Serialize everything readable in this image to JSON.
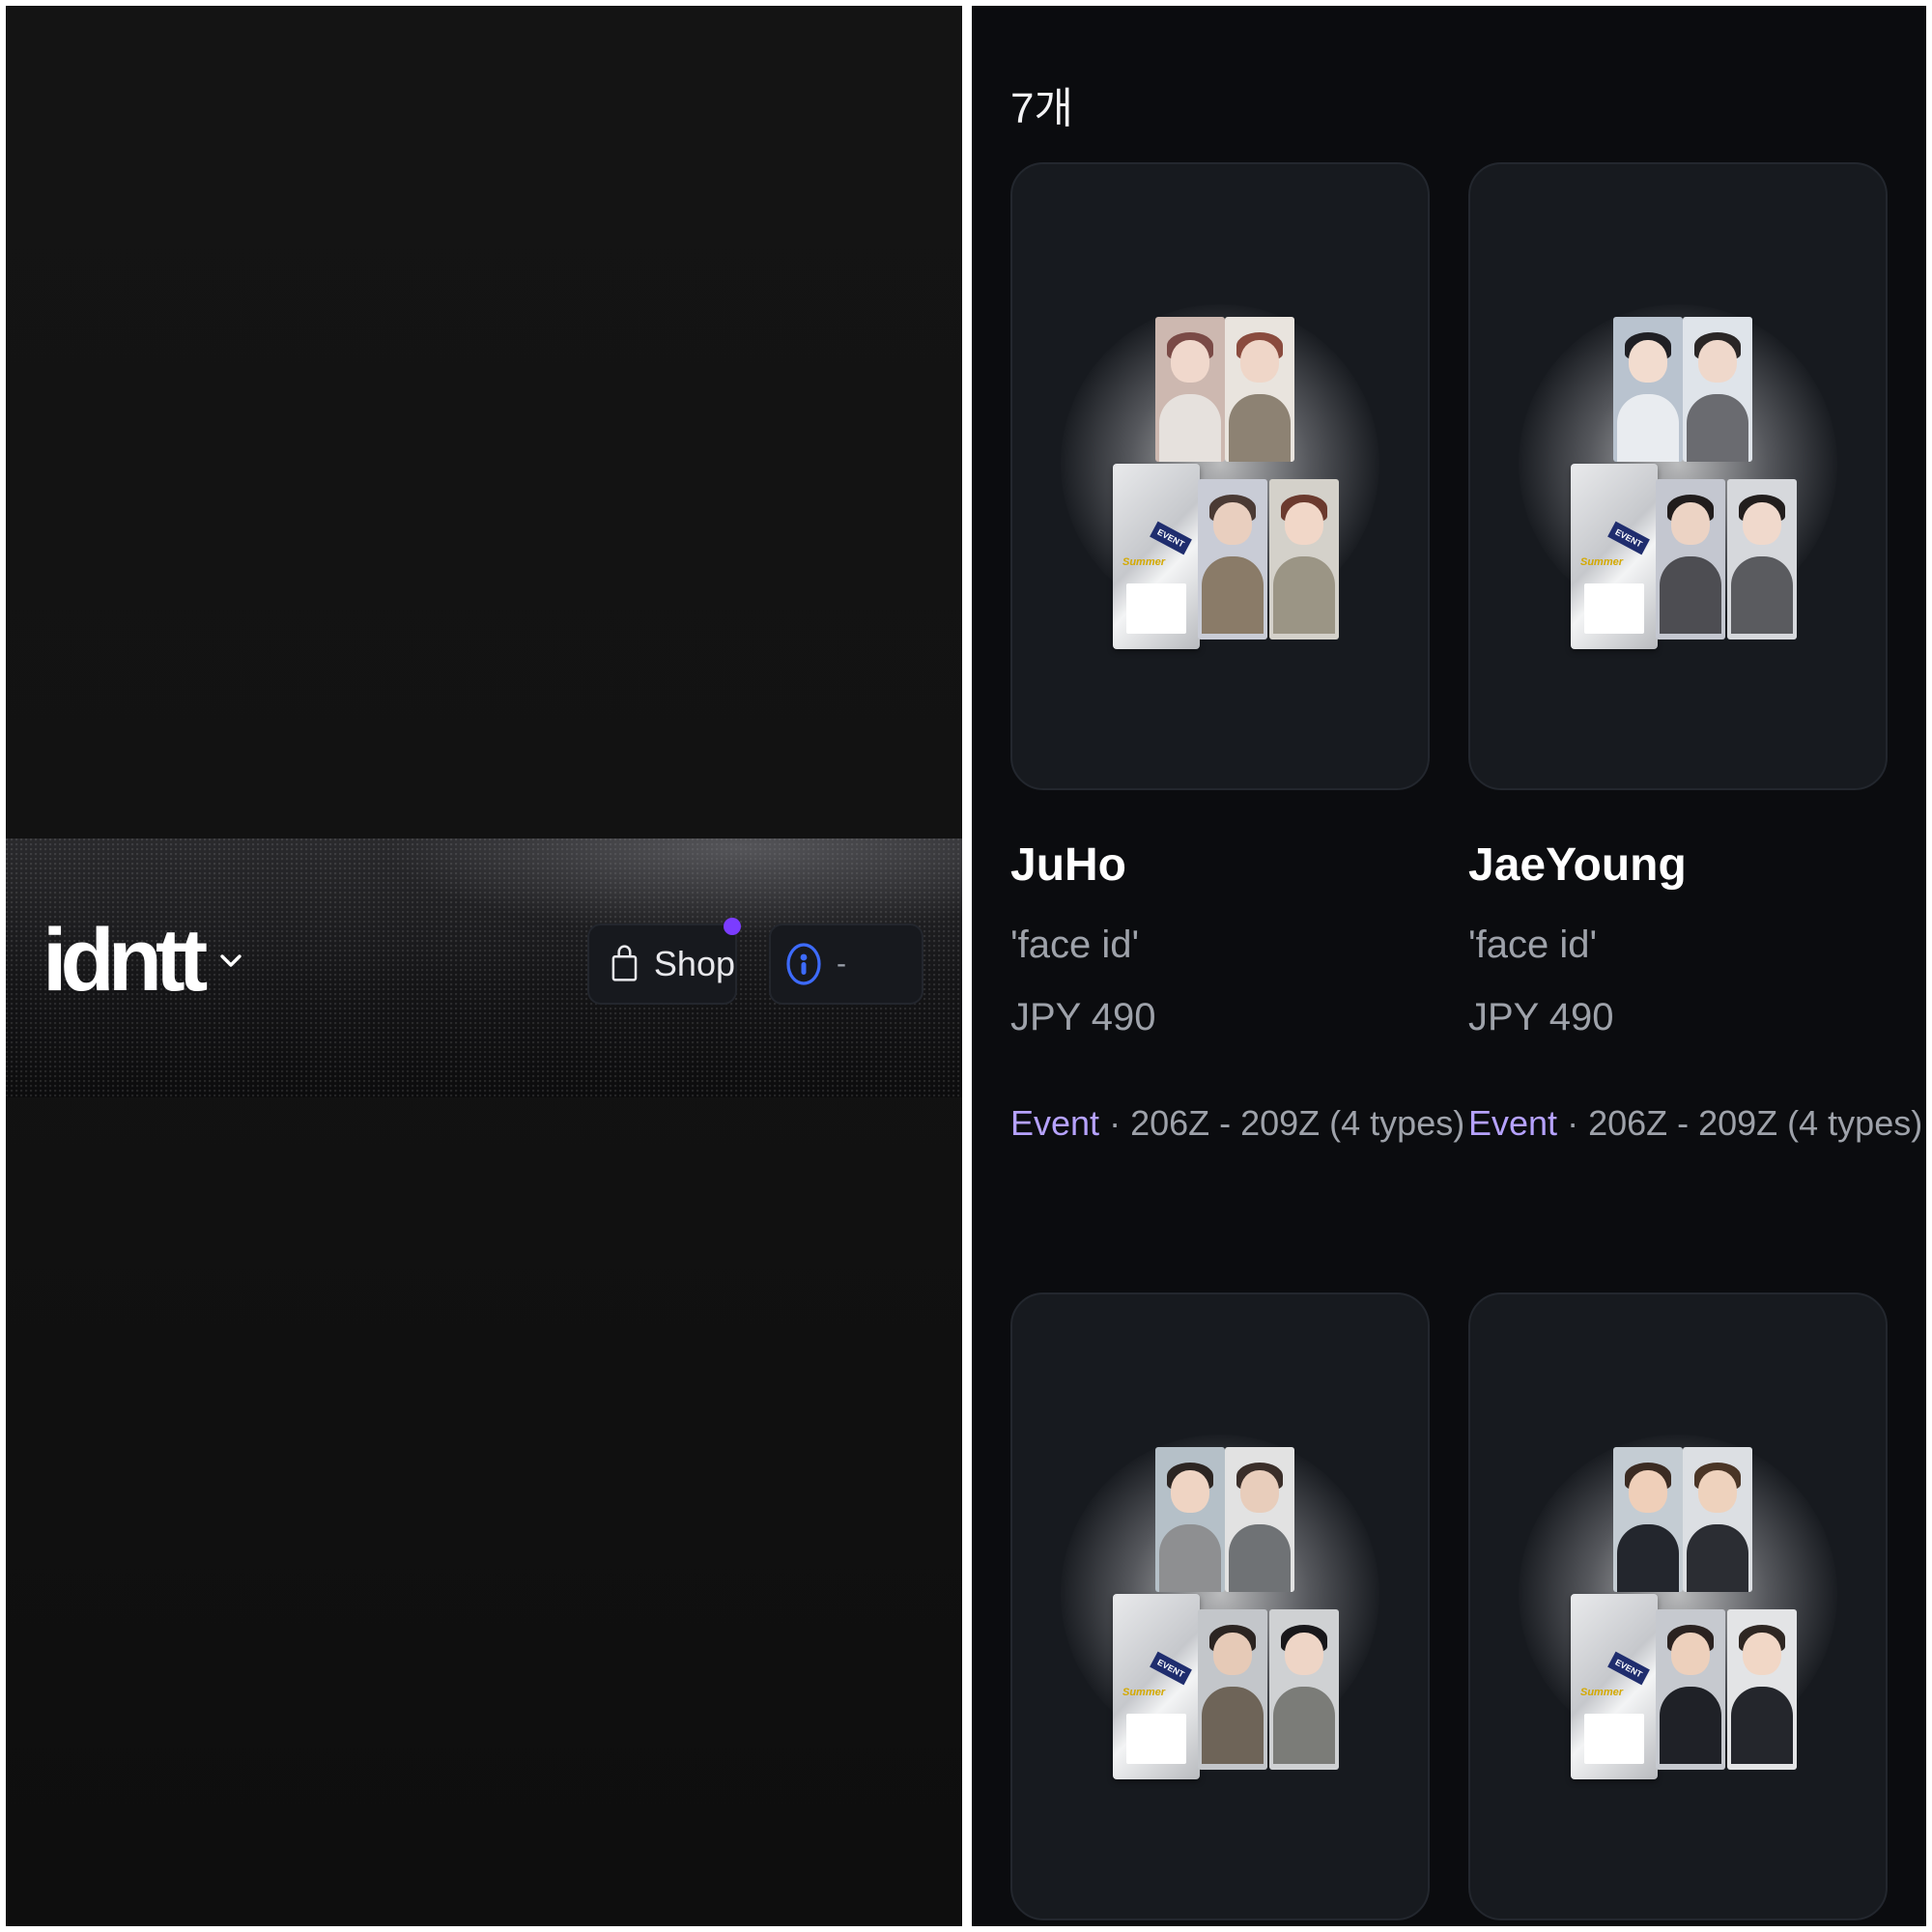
{
  "left_panel": {
    "brand": {
      "logo_text": "idntt"
    },
    "nav": {
      "shop_label": "Shop",
      "shop_badge_color": "#7b3cff",
      "coin_value": "-",
      "icons": [
        "chevron-down-icon",
        "shopping-bag-icon",
        "coin-icon"
      ]
    }
  },
  "right_panel": {
    "count_label": "7개",
    "accent_color": "#b6a2ff",
    "products": [
      {
        "name": "JuHo",
        "subtitle": "'face id'",
        "price": "JPY 490",
        "tag": "Event",
        "separator": " · ",
        "range": "206Z - 209Z (4 types)"
      },
      {
        "name": "JaeYoung",
        "subtitle": "'face id'",
        "price": "JPY 490",
        "tag": "Event",
        "separator": " · ",
        "range": "206Z - 209Z (4 types)"
      },
      {
        "name": "",
        "subtitle": "",
        "price": "",
        "tag": "",
        "separator": "",
        "range": ""
      },
      {
        "name": "",
        "subtitle": "",
        "price": "",
        "tag": "",
        "separator": "",
        "range": ""
      }
    ],
    "pack_texts": {
      "sticker": "EVENT",
      "theme": "Summer"
    }
  }
}
